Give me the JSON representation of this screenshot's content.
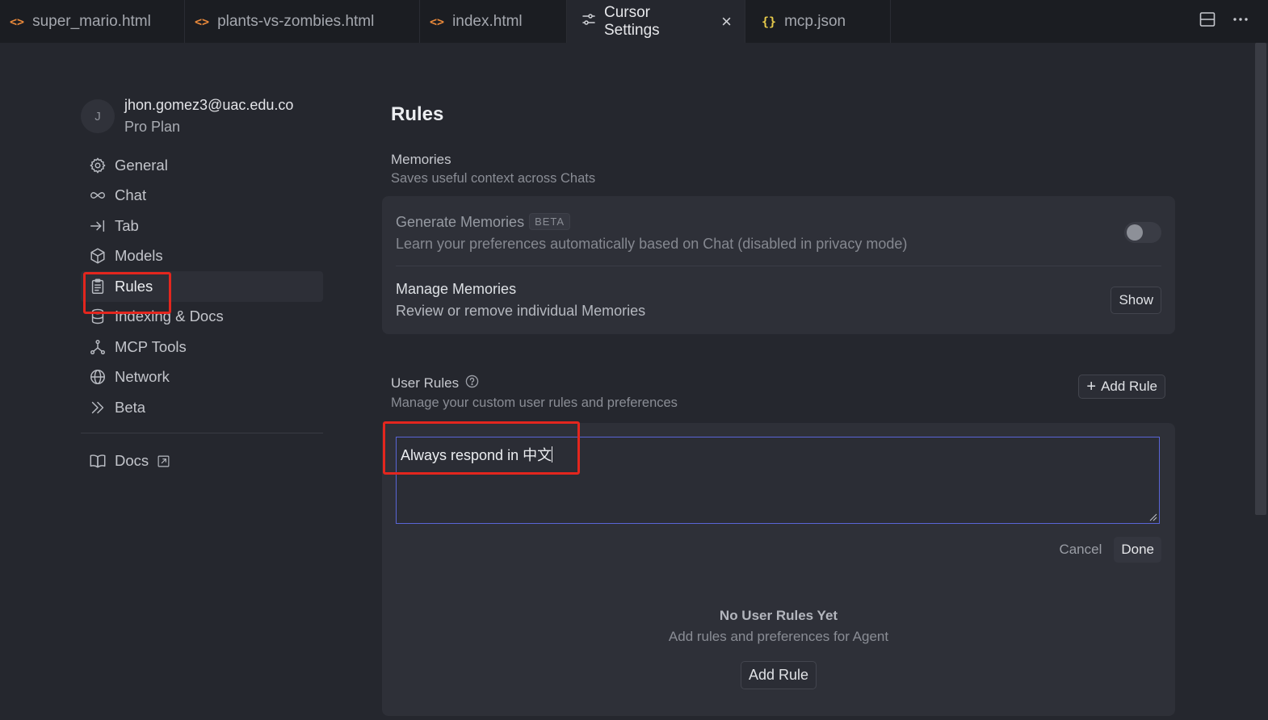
{
  "tabs": [
    {
      "icon": "code-icon",
      "label": "super_mario.html"
    },
    {
      "icon": "code-icon",
      "label": "plants-vs-zombies.html"
    },
    {
      "icon": "code-icon",
      "label": "index.html"
    },
    {
      "icon": "settings-sliders-icon",
      "label": "Cursor Settings",
      "active": true
    },
    {
      "icon": "json-braces-icon",
      "label": "mcp.json"
    }
  ],
  "user": {
    "initial": "J",
    "email": "jhon.gomez3@uac.edu.co",
    "plan": "Pro Plan"
  },
  "sidebar": {
    "items": [
      {
        "label": "General",
        "icon": "gear-icon"
      },
      {
        "label": "Chat",
        "icon": "infinity-icon"
      },
      {
        "label": "Tab",
        "icon": "arrow-tab-icon"
      },
      {
        "label": "Models",
        "icon": "cube-icon"
      },
      {
        "label": "Rules",
        "icon": "clipboard-icon",
        "active": true
      },
      {
        "label": "Indexing & Docs",
        "icon": "database-icon"
      },
      {
        "label": "MCP Tools",
        "icon": "nodes-icon"
      },
      {
        "label": "Network",
        "icon": "globe-icon"
      },
      {
        "label": "Beta",
        "icon": "chevrons-right-icon"
      }
    ],
    "docs": {
      "label": "Docs",
      "icon": "book-icon"
    }
  },
  "main": {
    "title": "Rules",
    "memories": {
      "label": "Memories",
      "desc": "Saves useful context across Chats",
      "generate": {
        "title": "Generate Memories",
        "badge": "BETA",
        "desc": "Learn your preferences automatically based on Chat (disabled in privacy mode)",
        "enabled": false
      },
      "manage": {
        "title": "Manage Memories",
        "desc": "Review or remove individual Memories",
        "button": "Show"
      }
    },
    "user_rules": {
      "label": "User Rules",
      "desc": "Manage your custom user rules and preferences",
      "add_button": "Add Rule",
      "editor_value": "Always respond in 中文",
      "cancel": "Cancel",
      "done": "Done",
      "empty_title": "No User Rules Yet",
      "empty_desc": "Add rules and preferences for Agent",
      "empty_button": "Add Rule"
    }
  },
  "colors": {
    "accent_border": "#5965d6",
    "highlight": "#e3261e",
    "code_icon": "#e8883a",
    "json_icon": "#e5c94a"
  }
}
